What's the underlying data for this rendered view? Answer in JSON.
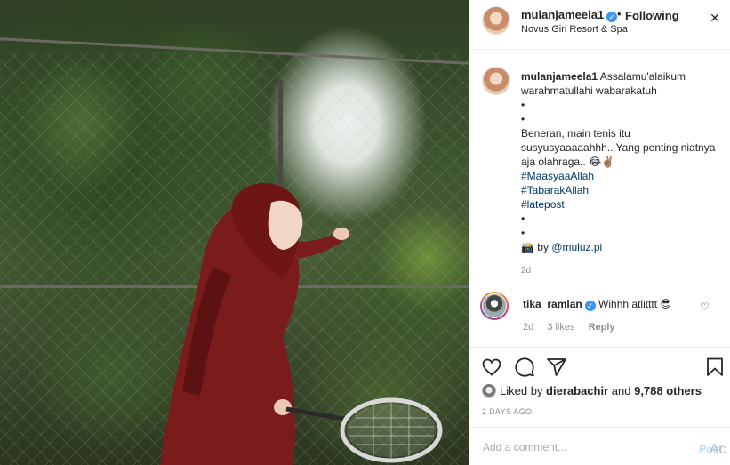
{
  "post": {
    "photo_alt": "",
    "header": {
      "username": "mulanjameela1",
      "follow_dot": "•",
      "follow_label": "Following",
      "location": "Novus Giri Resort & Spa",
      "close_icon": "close-icon"
    },
    "caption": {
      "username": "mulanjameela1",
      "first_line": "Assalamu'alaikum warahmatullahi wabarakatuh",
      "bullet1": "•",
      "bullet2": "•",
      "body": "Beneran, main tenis itu susyusyaaaaahhh.. Yang penting niatnya aja olahraga..",
      "emojis": "😂✌🏽",
      "hashtags": [
        "#MaasyaaAllah",
        "#TabarakAllah",
        "#latepost"
      ],
      "bullet3": "•",
      "bullet4": "•",
      "camera_emoji": "📸",
      "credit_prefix": "by",
      "credit_handle": "@muluz.pi",
      "age": "2d"
    },
    "comment": {
      "username": "tika_ramlan",
      "text": "Wihhh atlitttt",
      "emoji": "😎",
      "age": "2d",
      "likes": "3 likes",
      "reply_label": "Reply",
      "heart_icon": "heart-outline-icon"
    },
    "actions": {
      "like_icon": "heart-outline-icon",
      "comment_icon": "comment-icon",
      "share_icon": "paper-plane-icon",
      "save_icon": "bookmark-icon"
    },
    "likes": {
      "prefix": "Liked by",
      "liker": "dierabachir",
      "joiner": "and",
      "others": "9,788 others"
    },
    "timestamp": "2 DAYS AGO",
    "add_comment": {
      "placeholder": "Add a comment...",
      "post_label": "Post",
      "watermark": "Ac"
    },
    "colors": {
      "link": "#00376b",
      "verified": "#3897f0",
      "muted": "#8e8e8e",
      "post_disabled": "#b2dffc",
      "dress": "#7a1c1c"
    }
  }
}
